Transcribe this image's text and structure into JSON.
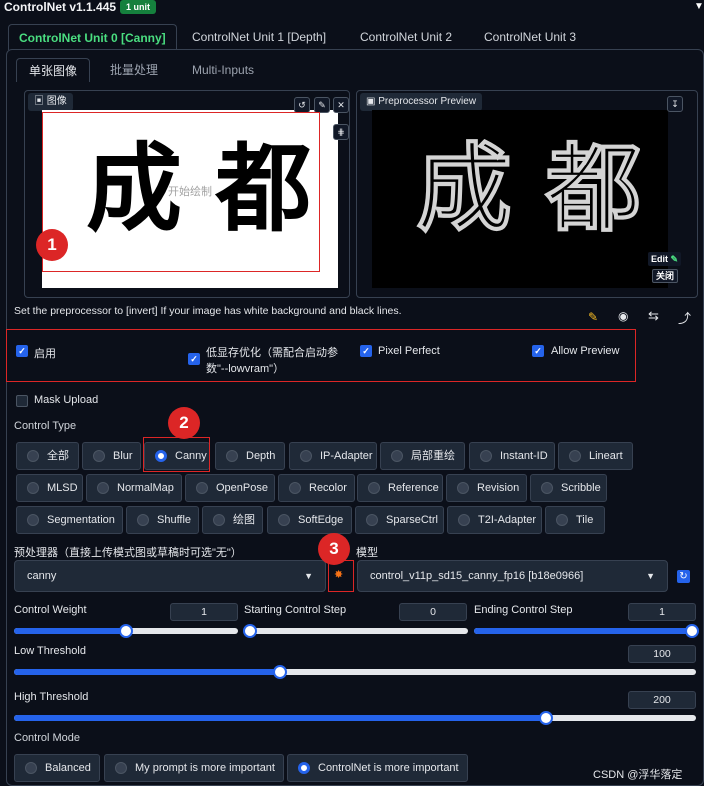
{
  "header": {
    "title": "ControlNet v1.1.445",
    "badge": "1 unit"
  },
  "unit_tabs": [
    "ControlNet Unit 0 [Canny]",
    "ControlNet Unit 1 [Depth]",
    "ControlNet Unit 2",
    "ControlNet Unit 3"
  ],
  "mode_tabs": [
    "单张图像",
    "批量处理",
    "Multi-Inputs"
  ],
  "image_label": "图像",
  "upload_hint": "开始绘制",
  "preview_label": "Preprocessor Preview",
  "preview_edit": "Edit",
  "preview_close": "关闭",
  "calligraphy": "成 都",
  "note": "Set the preprocessor to [invert] If your image has white background and black lines.",
  "checks": {
    "enable": "启用",
    "lowvram": "低显存优化（需配合启动参数\"--lowvram\"）",
    "pixel_perfect": "Pixel Perfect",
    "allow_preview": "Allow Preview",
    "mask_upload": "Mask Upload"
  },
  "control_type_label": "Control Type",
  "control_types": [
    "全部",
    "Blur",
    "Canny",
    "Depth",
    "IP-Adapter",
    "局部重绘",
    "Instant-ID",
    "Lineart",
    "MLSD",
    "NormalMap",
    "OpenPose",
    "Recolor",
    "Reference",
    "Revision",
    "Scribble",
    "Segmentation",
    "Shuffle",
    "绘图",
    "SoftEdge",
    "SparseCtrl",
    "T2I-Adapter",
    "Tile"
  ],
  "selected_control_type": "Canny",
  "preprocessor_label": "预处理器（直接上传模式图或草稿时可选\"无\"）",
  "preprocessor_value": "canny",
  "model_label": "模型",
  "model_value": "control_v11p_sd15_canny_fp16 [b18e0966]",
  "sliders": {
    "control_weight": {
      "label": "Control Weight",
      "value": "1",
      "fraction": 0.5
    },
    "start_step": {
      "label": "Starting Control Step",
      "value": "0",
      "fraction": 0.0
    },
    "end_step": {
      "label": "Ending Control Step",
      "value": "1",
      "fraction": 1.0
    },
    "low_threshold": {
      "label": "Low Threshold",
      "value": "100",
      "fraction": 0.39
    },
    "high_threshold": {
      "label": "High Threshold",
      "value": "200",
      "fraction": 0.78
    }
  },
  "control_mode_label": "Control Mode",
  "control_modes": [
    "Balanced",
    "My prompt is more important",
    "ControlNet is more important"
  ],
  "selected_control_mode": "ControlNet is more important",
  "annotations": [
    "1",
    "2",
    "3"
  ],
  "watermark": "CSDN @浮华落定",
  "colors": {
    "accent": "#2563eb",
    "active_tab": "#4ade80",
    "annotation": "#dc2626",
    "badge": "#15803d"
  }
}
